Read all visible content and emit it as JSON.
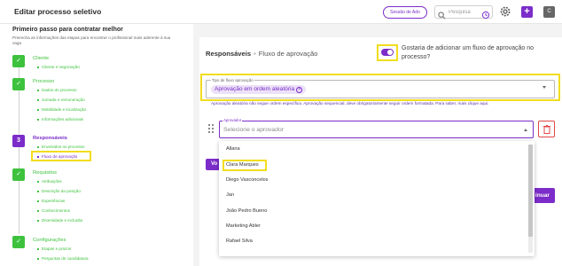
{
  "header": {
    "title": "Editar processo seletivo",
    "room_button": "Sessão de Ado",
    "search_placeholder": "Pesquisa",
    "avatar_initial": "C",
    "plus_label": "+"
  },
  "sidebar": {
    "title": "Primeiro passo para contratar melhor",
    "subtitle": "Preencha as informações das etapas para encontrar o profissional mais aderente à sua vaga",
    "steps": [
      {
        "badge": "✓",
        "name": "Cliente",
        "items": [
          "Cliente e negociação"
        ]
      },
      {
        "badge": "✓",
        "name": "Processo",
        "items": [
          "Dados do processo",
          "Jornada e remuneração",
          "Mobilidade e localização",
          "Informações adicionais"
        ]
      },
      {
        "badge": "3",
        "name": "Responsáveis",
        "items": [
          "Envolvidos no processo",
          "Fluxo de aprovação"
        ]
      },
      {
        "badge": "✓",
        "name": "Requisitos",
        "items": [
          "Atribuições",
          "Descrição da posição",
          "Experiências",
          "Conhecimentos",
          "Diversidade e inclusão"
        ]
      },
      {
        "badge": "✓",
        "name": "Configurações",
        "items": [
          "Etapas e prazos",
          "Perguntas de candidatura"
        ]
      }
    ]
  },
  "main": {
    "breadcrumb_section": "Responsáveis",
    "breadcrumb_sep": "•",
    "breadcrumb_page": "Fluxo de aprovação",
    "toggle_question": "Gostaria de adicionar um fluxo de aprovação no processo?",
    "toggle_on": true,
    "flow_type_label": "Tipo de fluxo aprovação",
    "flow_type_value": "Aprovação em ordem aleatória",
    "help_text": "Aprovação aleatória não segue ordem específica. Aprovação sequencial, deve obrigatoriamente seguir ordem formatada. Para saber, mais clique aqui.",
    "approver_label": "Aprovador",
    "approver_placeholder": "Selecione o aprovador",
    "back_button": "Vo",
    "next_button": "inuar",
    "approver_options": [
      "Allana",
      "Clara Marques",
      "Diego Vasconcelos",
      "Jan",
      "João Pedro Bueno",
      "Marketing Abler",
      "Rafael Silva"
    ]
  },
  "colors": {
    "accent": "#7b2cc9",
    "success": "#3ec23e",
    "highlight": "#f2dd1e",
    "danger": "#e04848"
  }
}
